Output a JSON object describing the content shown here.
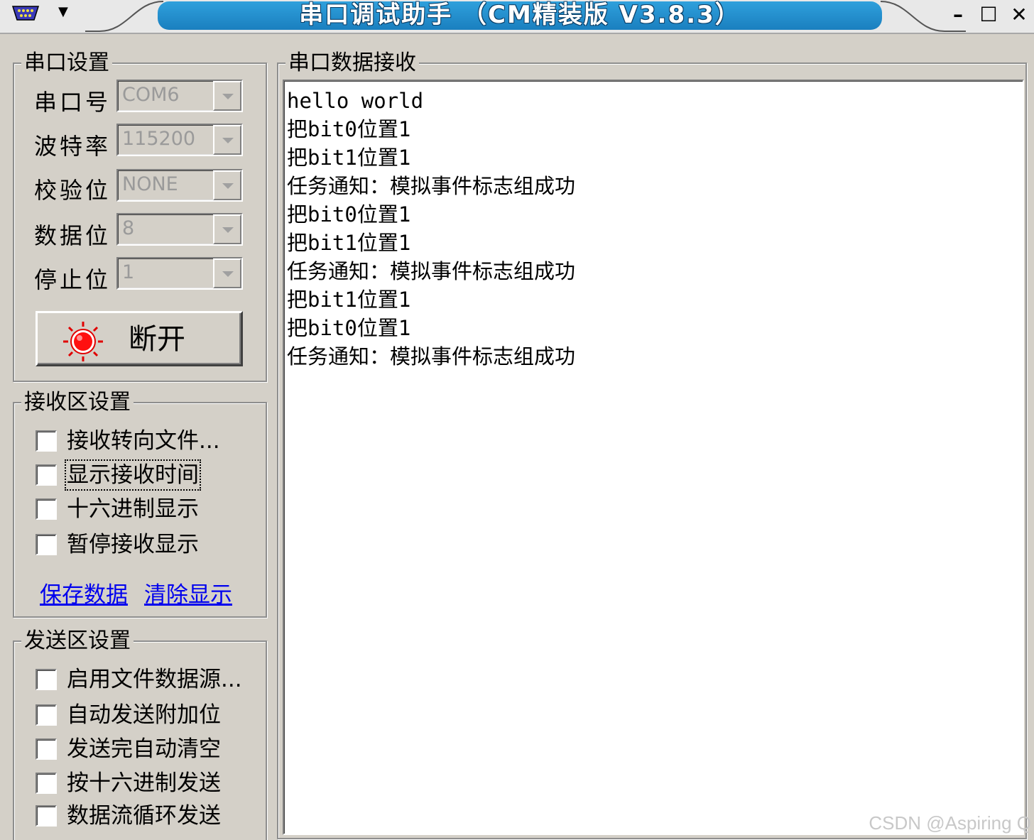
{
  "window": {
    "title": "串口调试助手 （CM精装版 V3.8.3）",
    "accent_color": "#1e8ccc"
  },
  "port_settings": {
    "title": "串口设置",
    "fields": [
      {
        "label": "串口号",
        "value": "COM6"
      },
      {
        "label": "波特率",
        "value": "115200"
      },
      {
        "label": "校验位",
        "value": "NONE"
      },
      {
        "label": "数据位",
        "value": "8"
      },
      {
        "label": "停止位",
        "value": "1"
      }
    ],
    "disconnect_label": "断开",
    "led_icon": "red-led-icon"
  },
  "receive_settings": {
    "title": "接收区设置",
    "options": [
      "接收转向文件...",
      "显示接收时间",
      "十六进制显示",
      "暂停接收显示"
    ],
    "save_link": "保存数据",
    "clear_link": "清除显示"
  },
  "send_settings": {
    "title": "发送区设置",
    "options": [
      "启用文件数据源...",
      "自动发送附加位",
      "发送完自动清空",
      "按十六进制发送",
      "数据流循环发送"
    ]
  },
  "receive": {
    "title": "串口数据接收",
    "lines": [
      "hello world",
      "把bit0位置1",
      "把bit1位置1",
      "任务通知：模拟事件标志组成功",
      "把bit0位置1",
      "把bit1位置1",
      "任务通知：模拟事件标志组成功",
      "把bit1位置1",
      "把bit0位置1",
      "任务通知：模拟事件标志组成功"
    ]
  },
  "watermark": "CSDN @Aspiring Q"
}
